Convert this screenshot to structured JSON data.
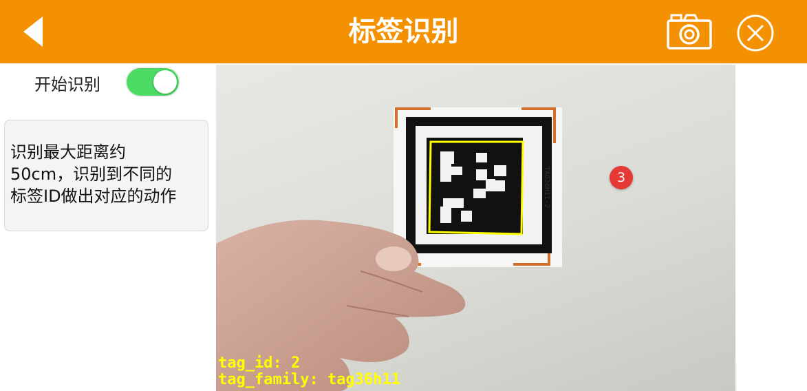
{
  "header": {
    "title": "标签识别",
    "accent_color": "#f39103",
    "back_icon": "chevron-left-icon",
    "camera_icon": "camera-icon",
    "close_icon": "close-circle-icon"
  },
  "sidebar": {
    "toggle_label": "开始识别",
    "toggle_on": true,
    "toggle_color": "#4cd964",
    "info_text": "识别最大距离约\n50cm，识别到不同的\n标签ID做出对应的动作"
  },
  "camera": {
    "tag_id_text": "tag_id: 2",
    "tag_family_text": "tag_family: tag36h11",
    "tag_side_label": "TAG36H11-2",
    "overlay_color": "#ffff00",
    "badge_count": "3"
  }
}
